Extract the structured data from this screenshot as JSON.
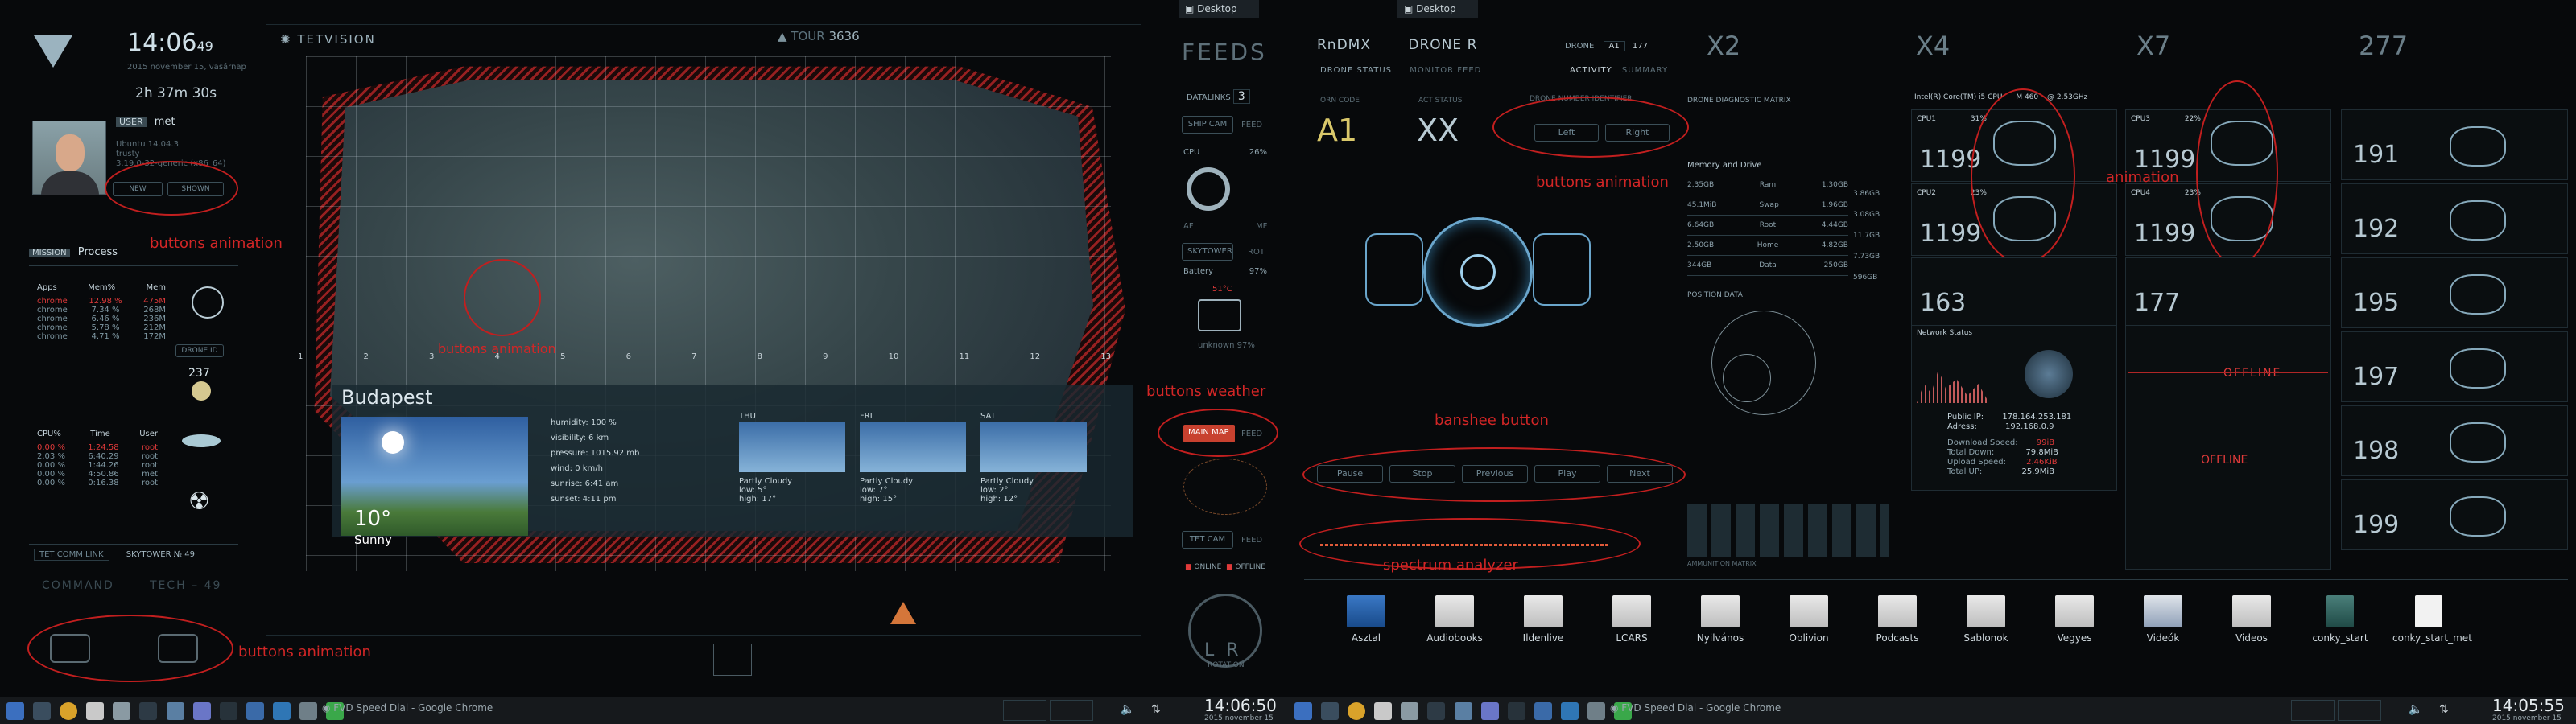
{
  "left": {
    "clock": {
      "time": "14:06",
      "seconds": "49",
      "date": "2015 november 15, vasárnap"
    },
    "uptime": "2h 37m 30s",
    "user": {
      "label": "USER",
      "name": "met"
    },
    "system": {
      "os": "Ubuntu 14.04.3",
      "codename": "trusty",
      "kernel": "3.19.0-32-generic (x86_64)"
    },
    "profile_buttons": [
      "NEW",
      "SHOWN"
    ],
    "mission": {
      "label": "MISSION",
      "value": "Process"
    },
    "mem_table": {
      "headers": [
        "Apps",
        "Mem%",
        "Mem"
      ],
      "rows": [
        [
          "chrome",
          "12.98 %",
          "475M"
        ],
        [
          "chrome",
          "7.34 %",
          "268M"
        ],
        [
          "chrome",
          "6.46 %",
          "236M"
        ],
        [
          "chrome",
          "5.78 %",
          "212M"
        ],
        [
          "chrome",
          "4.71 %",
          "172M"
        ]
      ]
    },
    "drone_label": "DRONE ID",
    "drone_value": "237",
    "cpu_table": {
      "headers": [
        "CPU%",
        "Time",
        "User"
      ],
      "rows": [
        [
          "0.00 %",
          "1:24.58",
          "root"
        ],
        [
          "2.03 %",
          "6:40.29",
          "root"
        ],
        [
          "0.00 %",
          "1:44.26",
          "root"
        ],
        [
          "0.00 %",
          "4:50.86",
          "met"
        ],
        [
          "0.00 %",
          "0:16.38",
          "root"
        ]
      ]
    },
    "comm": {
      "link": "TET COMM LINK",
      "tower": "SKYTOWER № 49"
    },
    "command": {
      "a": "COMMAND",
      "b": "TECH – 49"
    },
    "annotations": {
      "buttons1": "buttons animation",
      "buttons2": "buttons animation"
    }
  },
  "map": {
    "brand": "TETVISION",
    "tour": "TOUR",
    "tour_num": "3636",
    "annotation": "buttons animation",
    "weather": {
      "city": "Budapest",
      "temp": "10°",
      "condition": "Sunny",
      "details": [
        "humidity: 100 %",
        "visibility: 6 km",
        "pressure: 1015.92 mb",
        "wind: 0 km/h",
        "sunrise: 6:41 am",
        "sunset: 4:11 pm"
      ],
      "forecast": [
        {
          "day": "THU",
          "cond": "Partly Cloudy",
          "low": "low: 5°",
          "high": "high: 17°"
        },
        {
          "day": "FRI",
          "cond": "Partly Cloudy",
          "low": "low: 7°",
          "high": "high: 15°"
        },
        {
          "day": "SAT",
          "cond": "Partly Cloudy",
          "low": "low: 2°",
          "high": "high: 12°"
        }
      ]
    },
    "grid_labels": [
      "1",
      "2",
      "3",
      "4",
      "5",
      "6",
      "7",
      "8",
      "9",
      "10",
      "11",
      "12",
      "13"
    ]
  },
  "feeds": {
    "desktop_tab": "Desktop",
    "title": "FEEDS",
    "datalinks": "DATALINKS",
    "datalinks_num": "3",
    "ship_cam": "SHIP CAM",
    "feed": "FEED",
    "cpu": "CPU",
    "cpu_pct": "26%",
    "af": "AF",
    "mf": "MF",
    "skytower": "SKYTOWER",
    "rot": "ROT",
    "battery": "Battery",
    "battery_pct": "97%",
    "unknown": "unknown 97%",
    "temp": "51°C",
    "main_map": "MAIN MAP",
    "tet_cam": "TET CAM",
    "online": "ONLINE",
    "offline": "OFFLINE",
    "rotation": "ROTATION",
    "lr": "L R",
    "annotation": "buttons weather"
  },
  "taskbar_left": {
    "app": "FVD Speed Dial - Google Chrome",
    "time": "14:06:50",
    "date": "2015 november 15"
  },
  "right": {
    "desktop_tab": "Desktop",
    "header": {
      "rn": "RnDMX",
      "drone": "DRONE",
      "r": "R",
      "drone_label": "DRONE",
      "a1": "A1",
      "num": "177",
      "x2": "X2"
    },
    "subheader": {
      "status": "DRONE STATUS",
      "monitor": "MONITOR FEED",
      "activity": "ACTIVITY",
      "summary": "SUMMARY"
    },
    "orn_code": "ORN CODE",
    "act_status": "ACT STATUS",
    "a1_big": "A1",
    "xx_big": "XX",
    "drone_number": "DRONE",
    "number_label": "NUMBER IDENTIFIER",
    "left_right": [
      "Left",
      "Right"
    ],
    "annotation_buttons": "buttons animation",
    "diagnostic": "DRONE DIAGNOSTIC MATRIX",
    "memory_title": "Memory and Drive",
    "memory_rows": [
      [
        "2.35GB",
        "Ram",
        "1.30GB",
        "3.86GB"
      ],
      [
        "45.1MiB",
        "Swap",
        "1.96GB",
        "3.08GB"
      ],
      [
        "6.64GB",
        "Root",
        "4.44GB",
        "11.7GB"
      ],
      [
        "2.50GB",
        "Home",
        "4.82GB",
        "7.73GB"
      ],
      [
        "344GB",
        "Data",
        "250GB",
        "596GB"
      ]
    ],
    "position_data": "POSITION DATA",
    "banshee": "banshee button",
    "player_buttons": [
      "Pause",
      "Stop",
      "Previous",
      "Play",
      "Next"
    ],
    "spectrum": "spectrum analyzer",
    "ammunition": "AMMUNITION MATRIX",
    "x4": "X4",
    "x7": "X7",
    "n277": "277",
    "cpu_title": "Intel(R) Core(TM) i5 CPU",
    "cpu_model": "M 460",
    "cpu_freq": "@ 2.53GHz",
    "cpus": [
      {
        "label": "CPU1",
        "pct": "31%",
        "val": "1199"
      },
      {
        "label": "CPU2",
        "pct": "23%",
        "val": "1199"
      },
      {
        "label": "CPU3",
        "pct": "22%",
        "val": "1199"
      },
      {
        "label": "CPU4",
        "pct": "23%",
        "val": "1199"
      }
    ],
    "unit_a": "163",
    "unit_b": "177",
    "animation": "animation",
    "drones_right": [
      "191",
      "192",
      "195",
      "197",
      "198",
      "199"
    ],
    "network": {
      "title": "Network Status",
      "public_ip_label": "Public IP:",
      "public_ip": "178.164.253.181",
      "address_label": "Adress:",
      "address": "192.168.0.9",
      "down_speed_label": "Download Speed:",
      "down_speed": "99iB",
      "total_down_label": "Total Down:",
      "total_down": "79.8MiB",
      "up_speed_label": "Upload Speed:",
      "up_speed": "2.46KiB",
      "total_up_label": "Total UP:",
      "total_up": "25.9MiB"
    },
    "offline1": "OFFLINE",
    "offline2": "OFFLINE",
    "files": [
      "Asztal",
      "Audiobooks",
      "Ildenlive",
      "LCARS",
      "Nyilvános",
      "Oblivion",
      "Podcasts",
      "Sablonok",
      "Vegyes",
      "Videók",
      "Videos",
      "conky_start",
      "conky_start_met"
    ]
  },
  "taskbar_right": {
    "app": "FVD Speed Dial - Google Chrome",
    "time": "14:05:55",
    "date": "2015 november 15"
  }
}
